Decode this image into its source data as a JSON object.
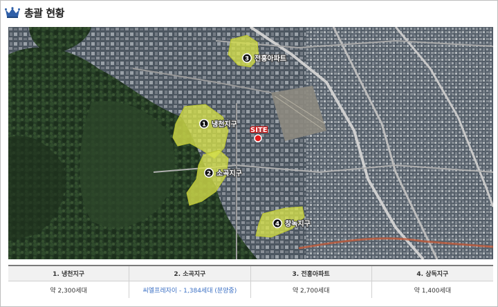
{
  "header": {
    "title": "총괄 현황"
  },
  "map": {
    "site_label": "SITE",
    "areas": [
      {
        "number": "1",
        "name": "냉천지구"
      },
      {
        "number": "2",
        "name": "소곡지구"
      },
      {
        "number": "3",
        "name": "전홍아파트"
      },
      {
        "number": "4",
        "name": "창녹지구"
      }
    ]
  },
  "table": {
    "headers": [
      "1. 냉천지구",
      "2. 소곡지구",
      "3. 전홍아파트",
      "4. 상독지구"
    ],
    "values": [
      "약 2,300세대",
      "씨엘프레자이 - 1,384세대 (분양중)",
      "약 2,700세대",
      "약 1,400세대"
    ]
  },
  "colors": {
    "highlight_area": "#d6e04a",
    "site_marker": "#e01b1b",
    "link_text": "#3a6fc4"
  }
}
